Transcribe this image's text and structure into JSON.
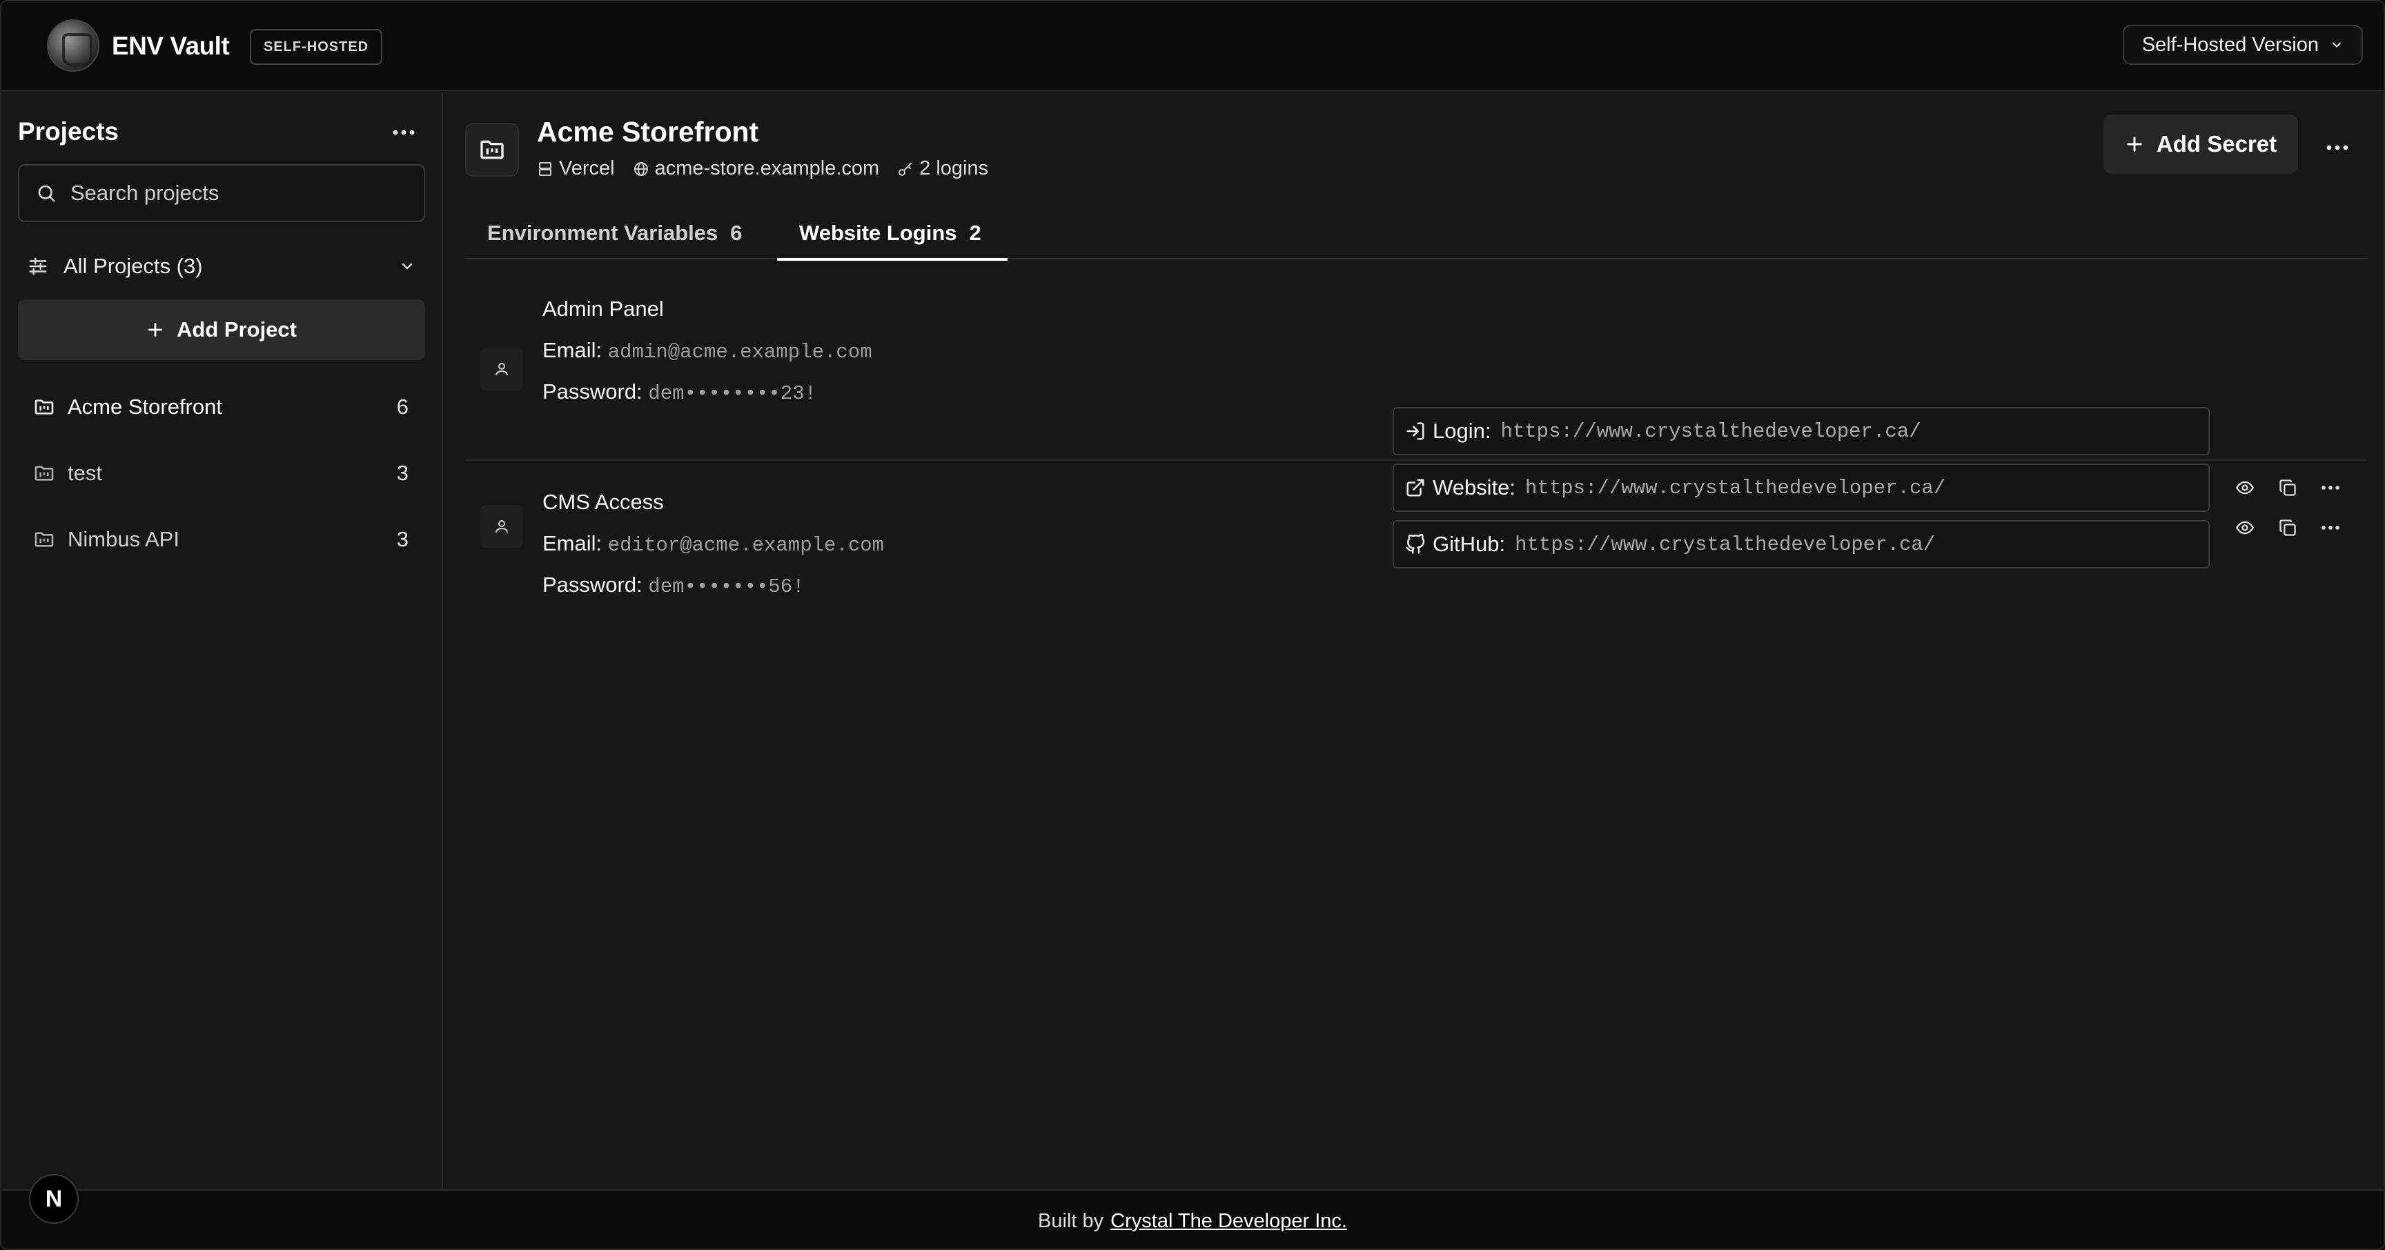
{
  "app": {
    "brand": "ENV Vault",
    "badge": "SELF-HOSTED",
    "version_select": "Self-Hosted Version"
  },
  "sidebar": {
    "title": "Projects",
    "search_placeholder": "Search projects",
    "filter_label": "All Projects (3)",
    "add_project_label": "Add Project",
    "projects": [
      {
        "name": "Acme Storefront",
        "count": "6"
      },
      {
        "name": "test",
        "count": "3"
      },
      {
        "name": "Nimbus API",
        "count": "3"
      }
    ]
  },
  "project": {
    "title": "Acme Storefront",
    "host": "Vercel",
    "domain": "acme-store.example.com",
    "logins": "2 logins",
    "add_secret_label": "Add Secret"
  },
  "tabs": [
    {
      "label": "Environment Variables",
      "count": "6"
    },
    {
      "label": "Website Logins",
      "count": "2"
    }
  ],
  "entries": [
    {
      "name": "Admin Panel",
      "email_label": "Email:",
      "email": "admin@acme.example.com",
      "password_label": "Password:",
      "password": "dem••••••••23!",
      "links": [
        {
          "label": "Login:",
          "url": "https://www.crystalthedeveloper.ca/",
          "icon": "login-icon"
        },
        {
          "label": "Website:",
          "url": "https://www.crystalthedeveloper.ca/",
          "icon": "external-link-icon"
        },
        {
          "label": "GitHub:",
          "url": "https://www.crystalthedeveloper.ca/",
          "icon": "github-icon"
        }
      ]
    },
    {
      "name": "CMS Access",
      "email_label": "Email:",
      "email": "editor@acme.example.com",
      "password_label": "Password:",
      "password": "dem•••••••56!"
    }
  ],
  "footer": {
    "prefix": "Built by",
    "link": "Crystal The Developer Inc.",
    "n_badge": "N"
  },
  "colors": {
    "background": "#171717",
    "topbar": "#0b0b0b",
    "accent": "#ffffff",
    "muted_value": "#9e9e9e"
  }
}
